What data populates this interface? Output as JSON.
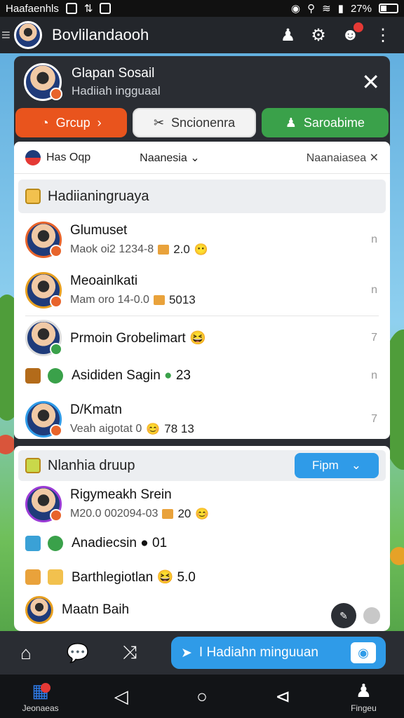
{
  "status_bar": {
    "left_text": "Haafaenhls",
    "battery": "27%"
  },
  "app_bar": {
    "title": "Bovlilandaooh"
  },
  "panel": {
    "title": "Glapan Sosail",
    "subtitle": "Hadiiah ingguaal",
    "tabs": [
      {
        "label": "Grcup"
      },
      {
        "label": "Sncionenra"
      },
      {
        "label": "Saroabime"
      }
    ],
    "filter": {
      "first": "Has Oqp",
      "second": "Naanesia",
      "third": "Naanaiasea"
    }
  },
  "section1": {
    "title": "Hadiianingruaya",
    "rows": [
      {
        "name": "Glumuset",
        "meta": "Maok oi2 1234-8",
        "value": "2.0",
        "more": "n"
      },
      {
        "name": "Meoainlkati",
        "meta": "Mam oro 14-0.0",
        "value": "5013",
        "more": "n"
      },
      {
        "name": "Prmoin Grobelimart",
        "meta": "",
        "value": "",
        "more": "7"
      },
      {
        "name": "Asididen Sagin",
        "meta": "",
        "value": "23",
        "more": "n"
      },
      {
        "name": "D/Kmatn",
        "meta": "Veah aigotat 0",
        "value": "78 13",
        "more": "7"
      }
    ]
  },
  "section2": {
    "title": "Nlanhia druup",
    "follow_label": "Fipm",
    "rows": [
      {
        "name": "Rigymeakh Srein",
        "meta": "M20.0 002094-03",
        "value": "20"
      },
      {
        "name": "Anadiecsin",
        "meta": "",
        "value": "01"
      },
      {
        "name": "Barthlegiotlan",
        "meta": "",
        "value": "5.0"
      },
      {
        "name": "Maatn Baih",
        "meta": "",
        "value": ""
      }
    ]
  },
  "bottom_action": {
    "label": "I Hadiahn minguuan"
  },
  "nav": {
    "home_label": "Jeonaeas",
    "profile_label": "Fingeu"
  },
  "colors": {
    "accent_orange": "#e9541d",
    "accent_green": "#3aa14a",
    "accent_blue": "#2f9be8"
  }
}
